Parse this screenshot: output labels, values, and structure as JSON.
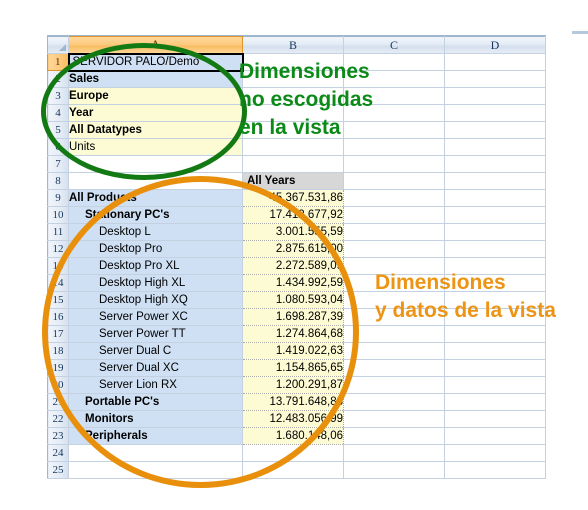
{
  "app": {
    "type": "spreadsheet",
    "colors": {
      "annotation_green": "#0c8a18",
      "annotation_orange": "#ed9415",
      "dimension_cell_fill": "#fdfbd3",
      "data_row_fill": "#cfe0f4",
      "value_cell_fill": "#fdfbd3",
      "header_cell_fill": "#d7d7d7"
    }
  },
  "grid": {
    "column_headers": [
      "A",
      "B",
      "C",
      "D"
    ],
    "row_headers": [
      "1",
      "2",
      "3",
      "4",
      "5",
      "6",
      "7",
      "8",
      "9",
      "10",
      "11",
      "12",
      "13",
      "14",
      "15",
      "16",
      "17",
      "18",
      "19",
      "20",
      "21",
      "22",
      "23",
      "24",
      "25"
    ],
    "selected_cell": "A1",
    "rows": [
      {
        "num": "1",
        "a": "SERVIDOR PALO/Demo",
        "b": "",
        "c": "",
        "d": "",
        "style": "selected"
      },
      {
        "num": "2",
        "a": "Sales",
        "b": "",
        "c": "",
        "d": "",
        "style": "blue-bold"
      },
      {
        "num": "3",
        "a": "Europe",
        "b": "",
        "c": "",
        "d": "",
        "style": "yellow-bold"
      },
      {
        "num": "4",
        "a": "Year",
        "b": "",
        "c": "",
        "d": "",
        "style": "yellow-bold"
      },
      {
        "num": "5",
        "a": "All Datatypes",
        "b": "",
        "c": "",
        "d": "",
        "style": "yellow-bold"
      },
      {
        "num": "6",
        "a": "Units",
        "b": "",
        "c": "",
        "d": "",
        "style": "yellow-plain"
      },
      {
        "num": "7",
        "a": "",
        "b": "",
        "c": "",
        "d": "",
        "style": "empty"
      },
      {
        "num": "8",
        "a": "",
        "b": "All Years",
        "c": "",
        "d": "",
        "style": "col-header"
      },
      {
        "num": "9",
        "a": "All Products",
        "b": "45.367.531,86",
        "c": "",
        "d": "",
        "style": "data-bold-0"
      },
      {
        "num": "10",
        "a": "Stationary PC's",
        "b": "17.412.677,92",
        "c": "",
        "d": "",
        "style": "data-bold-1"
      },
      {
        "num": "11",
        "a": "Desktop L",
        "b": "3.001.555,59",
        "c": "",
        "d": "",
        "style": "data-2"
      },
      {
        "num": "12",
        "a": "Desktop Pro",
        "b": "2.875.615,00",
        "c": "",
        "d": "",
        "style": "data-2"
      },
      {
        "num": "13",
        "a": "Desktop Pro XL",
        "b": "2.272.589,09",
        "c": "",
        "d": "",
        "style": "data-2"
      },
      {
        "num": "14",
        "a": "Desktop High XL",
        "b": "1.434.992,59",
        "c": "",
        "d": "",
        "style": "data-2"
      },
      {
        "num": "15",
        "a": "Desktop High XQ",
        "b": "1.080.593,04",
        "c": "",
        "d": "",
        "style": "data-2"
      },
      {
        "num": "16",
        "a": "Server Power XC",
        "b": "1.698.287,39",
        "c": "",
        "d": "",
        "style": "data-2"
      },
      {
        "num": "17",
        "a": "Server Power TT",
        "b": "1.274.864,68",
        "c": "",
        "d": "",
        "style": "data-2"
      },
      {
        "num": "18",
        "a": "Server Dual C",
        "b": "1.419.022,63",
        "c": "",
        "d": "",
        "style": "data-2"
      },
      {
        "num": "19",
        "a": "Server Dual XC",
        "b": "1.154.865,65",
        "c": "",
        "d": "",
        "style": "data-2"
      },
      {
        "num": "20",
        "a": "Server Lion RX",
        "b": "1.200.291,87",
        "c": "",
        "d": "",
        "style": "data-2"
      },
      {
        "num": "21",
        "a": "Portable PC's",
        "b": "13.791.648,88",
        "c": "",
        "d": "",
        "style": "data-bold-1"
      },
      {
        "num": "22",
        "a": "Monitors",
        "b": "12.483.056,99",
        "c": "",
        "d": "",
        "style": "data-bold-1"
      },
      {
        "num": "23",
        "a": "Peripherals",
        "b": "1.680.148,06",
        "c": "",
        "d": "",
        "style": "data-bold-1"
      },
      {
        "num": "24",
        "a": "",
        "b": "",
        "c": "",
        "d": "",
        "style": "empty"
      },
      {
        "num": "25",
        "a": "",
        "b": "",
        "c": "",
        "d": "",
        "style": "empty"
      }
    ]
  },
  "annotations": {
    "green": {
      "line1": "Dimensiones",
      "line2": "no escogidas",
      "line3": "en la vista"
    },
    "orange": {
      "line1": "Dimensiones",
      "line2": "y datos de la vista"
    }
  }
}
